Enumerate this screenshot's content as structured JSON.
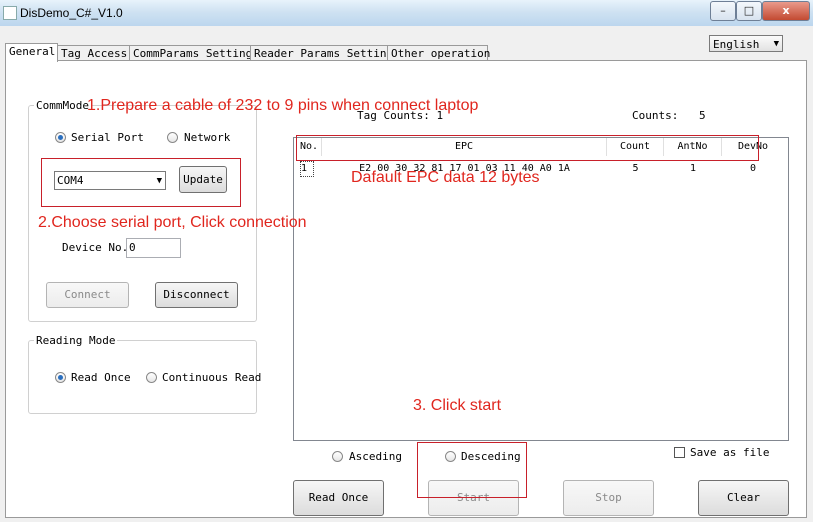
{
  "window": {
    "title": "DisDemo_C#_V1.0",
    "min_label": "–",
    "max_label": "□",
    "close_label": "x"
  },
  "language": {
    "selected": "English"
  },
  "tabs": [
    "General",
    "Tag Access",
    "CommParams Setting",
    "Reader Params Setting",
    "Other operation"
  ],
  "commmode": {
    "title": "CommMode",
    "serial_label": "Serial Port",
    "network_label": "Network",
    "port_value": "COM4",
    "update_label": "Update",
    "device_label": "Device No.",
    "device_value": "0",
    "connect_label": "Connect",
    "disconnect_label": "Disconnect"
  },
  "reading_mode": {
    "title": "Reading Mode",
    "once_label": "Read Once",
    "continuous_label": "Continuous Read"
  },
  "info": {
    "tag_counts_label": "Tag Counts:",
    "tag_counts_value": "1",
    "counts_label": "Counts:",
    "counts_value": "5"
  },
  "table": {
    "headers": [
      "No.",
      "EPC",
      "Count",
      "AntNo",
      "DevNo"
    ],
    "rows": [
      {
        "no": "1",
        "epc": "E2 00 30 32 81 17 01 03 11 40 A0 1A",
        "count": "5",
        "antno": "1",
        "devno": "0"
      }
    ]
  },
  "sort": {
    "asc_label": "Asceding",
    "desc_label": "Desceding"
  },
  "save_label": "Save as file",
  "buttons": {
    "read_once": "Read Once",
    "start": "Start",
    "stop": "Stop",
    "clear": "Clear"
  },
  "annotations": {
    "step1": "1.Prepare a cable of 232 to 9 pins when connect  laptop",
    "step2": "2.Choose serial port, Click connection",
    "epc_note": "Dafault EPC data 12 bytes",
    "step3": "3. Click start"
  },
  "colors": {
    "annotation": "#e0261e",
    "annotation_box": "#c8202a",
    "radio_selected": "#2a6fbf"
  }
}
